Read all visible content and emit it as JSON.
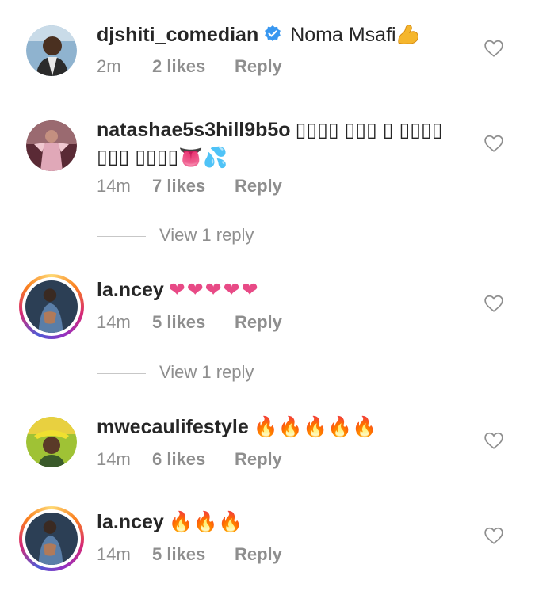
{
  "comments": [
    {
      "username": "djshiti_comedian",
      "verified": true,
      "text": "Noma Msafi",
      "emoji": "bicep",
      "time": "2m",
      "likes": "2 likes",
      "reply": "Reply",
      "avatar_color": "#6b8fb0"
    },
    {
      "username": "natashae5s3hill9b5o",
      "text": "▯▯▯▯ ▯▯▯ ▯ ▯▯▯▯ ▯▯▯ ▯▯▯▯",
      "emoji": "👅💦",
      "time": "14m",
      "likes": "7 likes",
      "reply": "Reply",
      "view_replies": "View 1 reply",
      "avatar_color": "#7a3a4a"
    },
    {
      "username": "la.ncey",
      "text": "❤❤❤❤❤",
      "time": "14m",
      "likes": "5 likes",
      "reply": "Reply",
      "view_replies": "View 1 reply",
      "avatar_color": "#2f4a6a"
    },
    {
      "username": "mwecaulifestyle",
      "text": "🔥🔥🔥🔥🔥",
      "time": "14m",
      "likes": "6 likes",
      "reply": "Reply",
      "avatar_color": "#a6c23a"
    },
    {
      "username": "la.ncey",
      "text": "🔥🔥🔥",
      "time": "14m",
      "likes": "5 likes",
      "reply": "Reply",
      "avatar_color": "#2f4a6a"
    }
  ],
  "colors": {
    "heart_pink": "#e84a86",
    "fire": "#f56a1e",
    "verified_blue": "#3897f0",
    "secondary_text": "#8e8e8e"
  }
}
